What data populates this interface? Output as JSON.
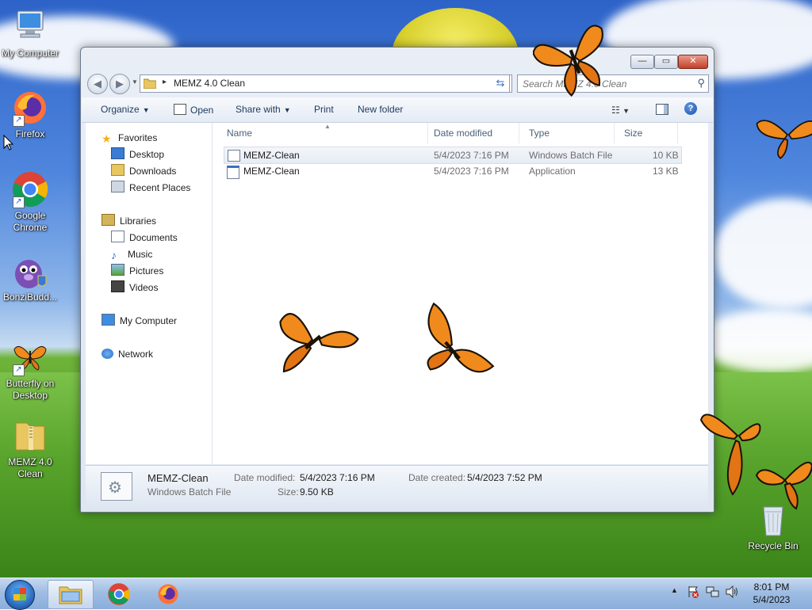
{
  "desktop": {
    "icons": [
      {
        "id": "my-computer",
        "label": "My Computer",
        "icon": "computer-icon"
      },
      {
        "id": "firefox",
        "label": "Firefox",
        "icon": "firefox-icon"
      },
      {
        "id": "chrome",
        "label": "Google Chrome",
        "icon": "chrome-icon"
      },
      {
        "id": "bonzi",
        "label": "BonziBudd...",
        "icon": "bonzi-buddy-icon"
      },
      {
        "id": "butterfly",
        "label": "Butterfly on Desktop",
        "icon": "butterfly-icon"
      },
      {
        "id": "memz",
        "label": "MEMZ 4.0 Clean",
        "icon": "zip-folder-icon"
      },
      {
        "id": "recycle",
        "label": "Recycle Bin",
        "icon": "recycle-bin-icon"
      }
    ]
  },
  "window": {
    "title_buttons": {
      "minimize": "—",
      "maximize": "▭",
      "close": "✕"
    },
    "address": {
      "path": "MEMZ 4.0 Clean",
      "separator": "▸"
    },
    "search": {
      "placeholder": "Search MEMZ 4.0 Clean"
    },
    "toolbar": {
      "organize": "Organize",
      "open": "Open",
      "share_with": "Share with",
      "print": "Print",
      "new_folder": "New folder"
    },
    "nav": {
      "favorites": "Favorites",
      "desktop": "Desktop",
      "downloads": "Downloads",
      "recent_places": "Recent Places",
      "libraries": "Libraries",
      "documents": "Documents",
      "music": "Music",
      "pictures": "Pictures",
      "videos": "Videos",
      "my_computer": "My Computer",
      "network": "Network"
    },
    "columns": {
      "name": "Name",
      "date_modified": "Date modified",
      "type": "Type",
      "size": "Size"
    },
    "files": [
      {
        "name": "MEMZ-Clean",
        "date": "5/4/2023 7:16 PM",
        "type": "Windows Batch File",
        "size": "10 KB",
        "icon": "batch-file-icon"
      },
      {
        "name": "MEMZ-Clean",
        "date": "5/4/2023 7:16 PM",
        "type": "Application",
        "size": "13 KB",
        "icon": "application-icon"
      }
    ],
    "details": {
      "name": "MEMZ-Clean",
      "type": "Windows Batch File",
      "modified_label": "Date modified:",
      "modified_value": "5/4/2023 7:16 PM",
      "created_label": "Date created:",
      "created_value": "5/4/2023 7:52 PM",
      "size_label": "Size:",
      "size_value": "9.50 KB"
    }
  },
  "taskbar": {
    "apps": [
      {
        "name": "Windows Explorer",
        "icon": "explorer-icon",
        "active": true
      },
      {
        "name": "Google Chrome",
        "icon": "chrome-icon",
        "active": false
      },
      {
        "name": "Firefox",
        "icon": "firefox-icon",
        "active": false
      }
    ],
    "tray": {
      "show_hidden": "▲"
    },
    "clock": {
      "time": "8:01 PM",
      "date": "5/4/2023"
    }
  },
  "colors": {
    "butterfly": "#f08a1c",
    "selection": "#e6ecf4",
    "taskbar": "#9fbde3"
  }
}
